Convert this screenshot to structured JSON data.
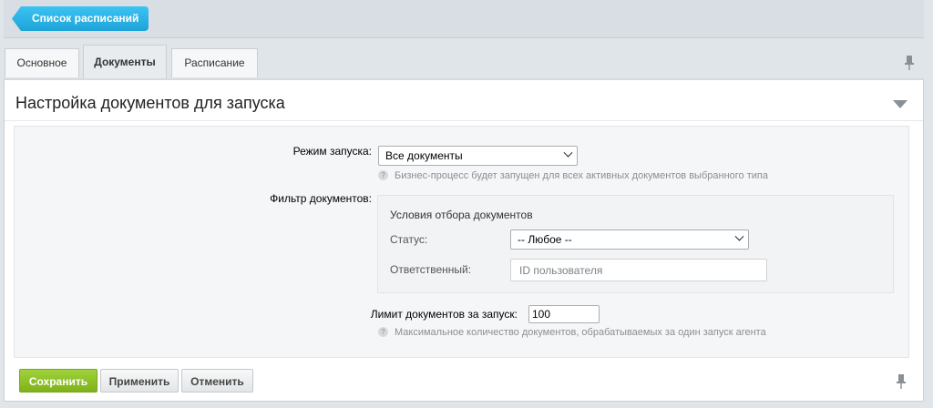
{
  "header": {
    "back_button_label": "Список расписаний"
  },
  "tabs": [
    {
      "label": "Основное",
      "active": false
    },
    {
      "label": "Документы",
      "active": true
    },
    {
      "label": "Расписание",
      "active": false
    }
  ],
  "section": {
    "title": "Настройка документов для запуска"
  },
  "form": {
    "launch_mode": {
      "label": "Режим запуска:",
      "selected": "Все документы",
      "hint": "Бизнес-процесс будет запущен для всех активных документов выбранного типа"
    },
    "filter": {
      "label": "Фильтр документов:",
      "box_title": "Условия отбора документов",
      "status_label": "Статус:",
      "status_selected": "-- Любое --",
      "responsible_label": "Ответственный:",
      "responsible_placeholder": "ID пользователя"
    },
    "limit": {
      "label": "Лимит документов за запуск:",
      "value": "100",
      "hint": "Максимальное количество документов, обрабатываемых за один запуск агента"
    }
  },
  "actions": {
    "save": "Сохранить",
    "apply": "Применить",
    "cancel": "Отменить"
  },
  "colors": {
    "accent_blue": "#1ea3d8",
    "save_green": "#8cc22a"
  }
}
